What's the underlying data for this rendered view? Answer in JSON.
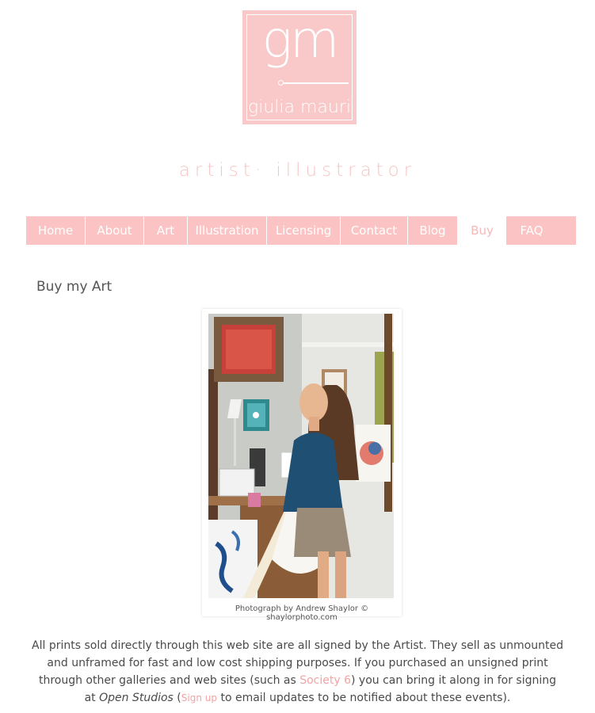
{
  "colors": {
    "brand_pink": "#f9c8c8",
    "nav_pink": "#fbc3c3",
    "link_pink": "#f4a3a3",
    "text": "#4a4a4a"
  },
  "logo": {
    "monogram": "gm",
    "name": "giulia mauri"
  },
  "tagline": "artist· illustrator",
  "nav": {
    "items": [
      {
        "label": "Home"
      },
      {
        "label": "About"
      },
      {
        "label": "Art"
      },
      {
        "label": "Illustration"
      },
      {
        "label": "Licensing"
      },
      {
        "label": "Contact"
      },
      {
        "label": "Blog"
      },
      {
        "label": "Buy"
      },
      {
        "label": "FAQ"
      }
    ],
    "active": "Buy"
  },
  "page": {
    "title": "Buy my Art",
    "photo_caption": "Photograph by Andrew Shaylor © shaylorphoto.com",
    "body": {
      "part1": "All prints sold directly through this web site are all signed by the Artist. They sell as unmounted and unframed for fast and low cost shipping purposes. If you purchased an unsigned print through other galleries and web sites (such as ",
      "link_society6": "Society 6",
      "part2": ") you can bring it along in for signing at ",
      "open_studios": "Open Studios",
      "part3": " (",
      "link_signup": "Sign up",
      "part4": " to email updates to be notified about these events)."
    }
  }
}
